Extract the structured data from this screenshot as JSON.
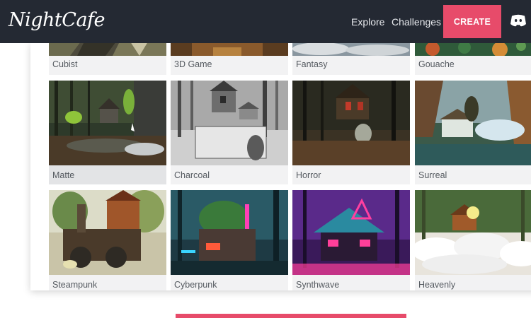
{
  "app": {
    "logo_text": "NightCafe"
  },
  "nav": {
    "explore": "Explore",
    "challenges": "Challenges",
    "create": "CREATE",
    "discord_icon": "discord-icon"
  },
  "styles": {
    "row1": [
      "Cubist",
      "3D Game",
      "Fantasy",
      "Gouache"
    ],
    "row2": [
      "Matte",
      "Charcoal",
      "Horror",
      "Surreal"
    ],
    "row3": [
      "Steampunk",
      "Cyberpunk",
      "Synthwave",
      "Heavenly"
    ],
    "selected": "Matte"
  },
  "colors": {
    "nav_bg": "#242933",
    "accent": "#e74b6a"
  }
}
